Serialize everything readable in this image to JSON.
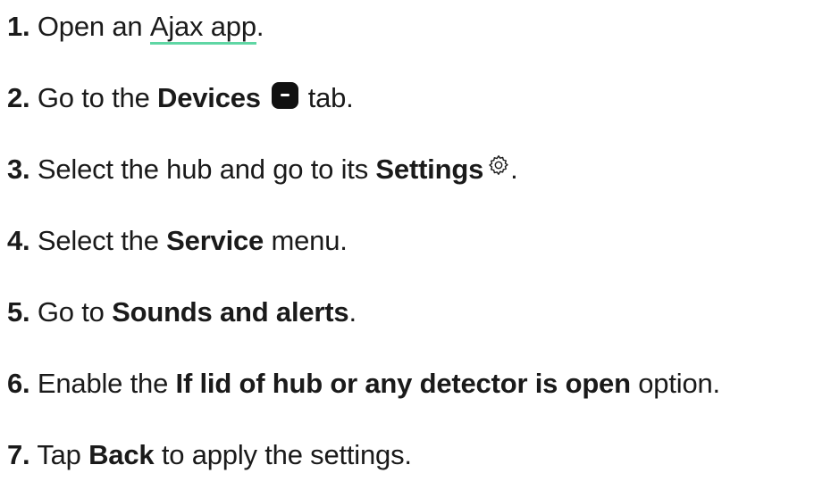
{
  "steps": [
    {
      "num": "1.",
      "t1": "Open an ",
      "link": "Ajax app",
      "t2": "."
    },
    {
      "num": "2.",
      "t1": "Go to the ",
      "b1": "Devices",
      "t2": "tab.",
      "icon": "devices-icon"
    },
    {
      "num": "3.",
      "t1": "Select the hub and go to its ",
      "b1": "Settings",
      "t2": ".",
      "icon": "gear-icon"
    },
    {
      "num": "4.",
      "t1": "Select the ",
      "b1": "Service",
      "t2": " menu."
    },
    {
      "num": "5.",
      "t1": "Go to ",
      "b1": "Sounds and alerts",
      "t2": "."
    },
    {
      "num": "6.",
      "t1": "Enable the ",
      "b1": "If lid of hub or any detector is open",
      "t2": " option."
    },
    {
      "num": "7.",
      "t1": "Tap ",
      "b1": "Back",
      "t2": " to apply the settings."
    }
  ],
  "colors": {
    "text": "#1a1a1a",
    "link_underline": "#5fd6a4",
    "icon_fill": "#111111"
  }
}
